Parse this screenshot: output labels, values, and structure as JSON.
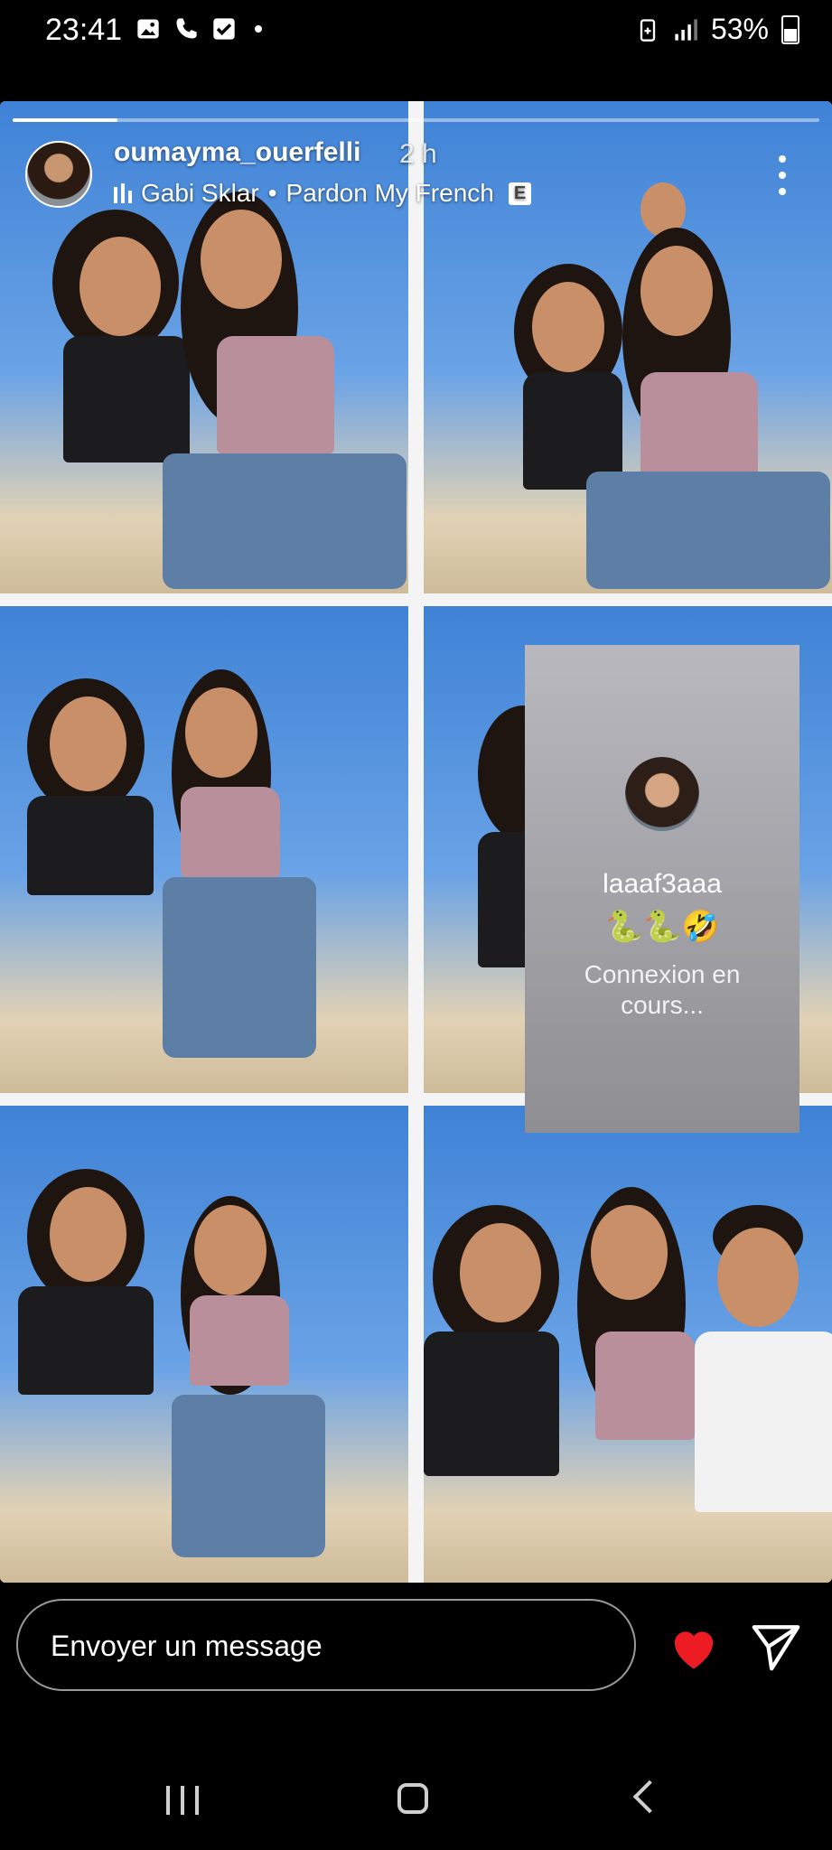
{
  "status_bar": {
    "time": "23:41",
    "battery": "53%",
    "icons_left": [
      "gallery-icon",
      "phone-icon",
      "checkbox-icon",
      "dot-icon"
    ],
    "icons_right": [
      "battery-saver-icon",
      "signal-icon",
      "battery-icon"
    ]
  },
  "story": {
    "progress_fraction": 0.13,
    "username": "oumayma_ouerfelli",
    "age": "2 h",
    "music": {
      "artist": "Gabi Sklar",
      "separator": "•",
      "track": "Pardon My French",
      "explicit_label": "E"
    }
  },
  "connection_card": {
    "name": "laaaf3aaa",
    "emoji": "🐍🐍🤣",
    "status": "Connexion en cours..."
  },
  "message_bar": {
    "placeholder": "Envoyer un message",
    "heart_color": "#ed1b24"
  },
  "colors": {
    "background": "#000000",
    "sky": "#3f82d6",
    "card": "#a0a0a5"
  }
}
